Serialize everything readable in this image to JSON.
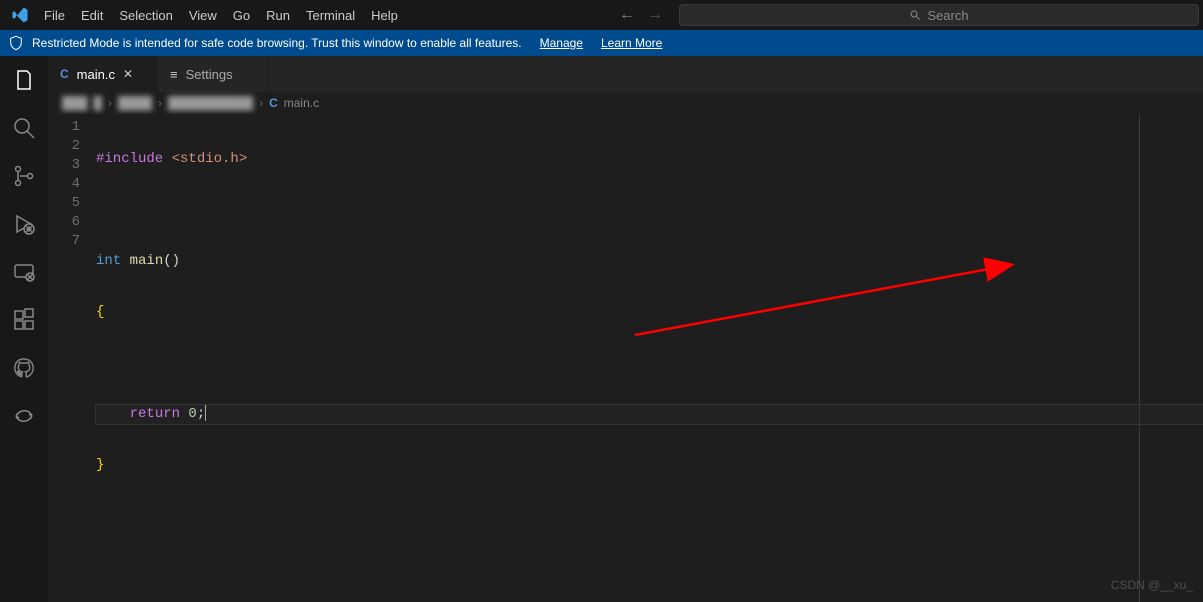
{
  "menu": [
    "File",
    "Edit",
    "Selection",
    "View",
    "Go",
    "Run",
    "Terminal",
    "Help"
  ],
  "search": {
    "placeholder": "Search"
  },
  "restricted": {
    "msg": "Restricted Mode is intended for safe code browsing. Trust this window to enable all features.",
    "manage": "Manage",
    "learn": "Learn More"
  },
  "tabs": [
    {
      "icon": "C",
      "label": "main.c",
      "active": true,
      "close": true
    },
    {
      "icon": "settings",
      "label": "Settings",
      "active": false
    }
  ],
  "breadcrumb": {
    "blur": [
      "███",
      "█",
      "████",
      "██████████"
    ],
    "file": "main.c"
  },
  "gutter": [
    "1",
    "2",
    "3",
    "4",
    "5",
    "6",
    "7"
  ],
  "code": {
    "l1": {
      "pre": "#include ",
      "inc": "<stdio.h>"
    },
    "l3": {
      "type": "int ",
      "fn": "main",
      "paren": "()"
    },
    "l4": "{",
    "l6": {
      "indent": "    ",
      "kw": "return ",
      "num": "0",
      "sc": ";"
    },
    "l7": "}"
  },
  "watermark": "CSDN @__xu_"
}
